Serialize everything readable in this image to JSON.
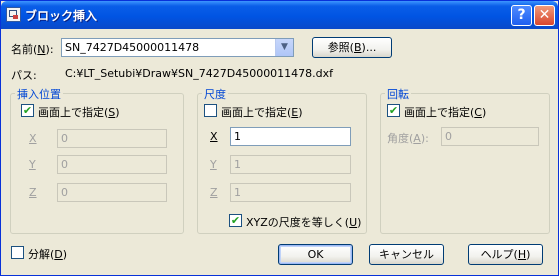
{
  "window": {
    "title": "ブロック挿入",
    "help_btn": "?",
    "close_btn": "✕"
  },
  "name": {
    "label": "名前(",
    "key": "N",
    "label_end": "):",
    "value": "SN_7427D45000011478",
    "browse_label": "参照(",
    "browse_key": "B",
    "browse_end": ")..."
  },
  "path": {
    "label": "パス:",
    "value": "C:¥LT_Setubi¥Draw¥SN_7427D45000011478.dxf"
  },
  "insertion": {
    "title": "挿入位置",
    "onscreen_label": "画面上で指定(",
    "onscreen_key": "S",
    "onscreen_end": ")",
    "onscreen_checked": true,
    "x_key": "X",
    "x_value": "0",
    "y_key": "Y",
    "y_value": "0",
    "z_key": "Z",
    "z_value": "0"
  },
  "scale": {
    "title": "尺度",
    "onscreen_label": "画面上で指定(",
    "onscreen_key": "E",
    "onscreen_end": ")",
    "onscreen_checked": false,
    "x_key": "X",
    "x_value": "1",
    "y_key": "Y",
    "y_value": "1",
    "z_key": "Z",
    "z_value": "1",
    "uniform_label": "XYZの尺度を等しく(",
    "uniform_key": "U",
    "uniform_end": ")",
    "uniform_checked": true
  },
  "rotation": {
    "title": "回転",
    "onscreen_label": "画面上で指定(",
    "onscreen_key": "C",
    "onscreen_end": ")",
    "onscreen_checked": true,
    "angle_label": "角度(",
    "angle_key": "A",
    "angle_end": "):",
    "angle_value": "0"
  },
  "explode": {
    "label": "分解(",
    "key": "D",
    "label_end": ")",
    "checked": false
  },
  "buttons": {
    "ok": "OK",
    "cancel": "キャンセル",
    "help_label": "ヘルプ(",
    "help_key": "H",
    "help_end": ")"
  },
  "icons": {
    "check": "✔",
    "dropdown": "▼"
  }
}
